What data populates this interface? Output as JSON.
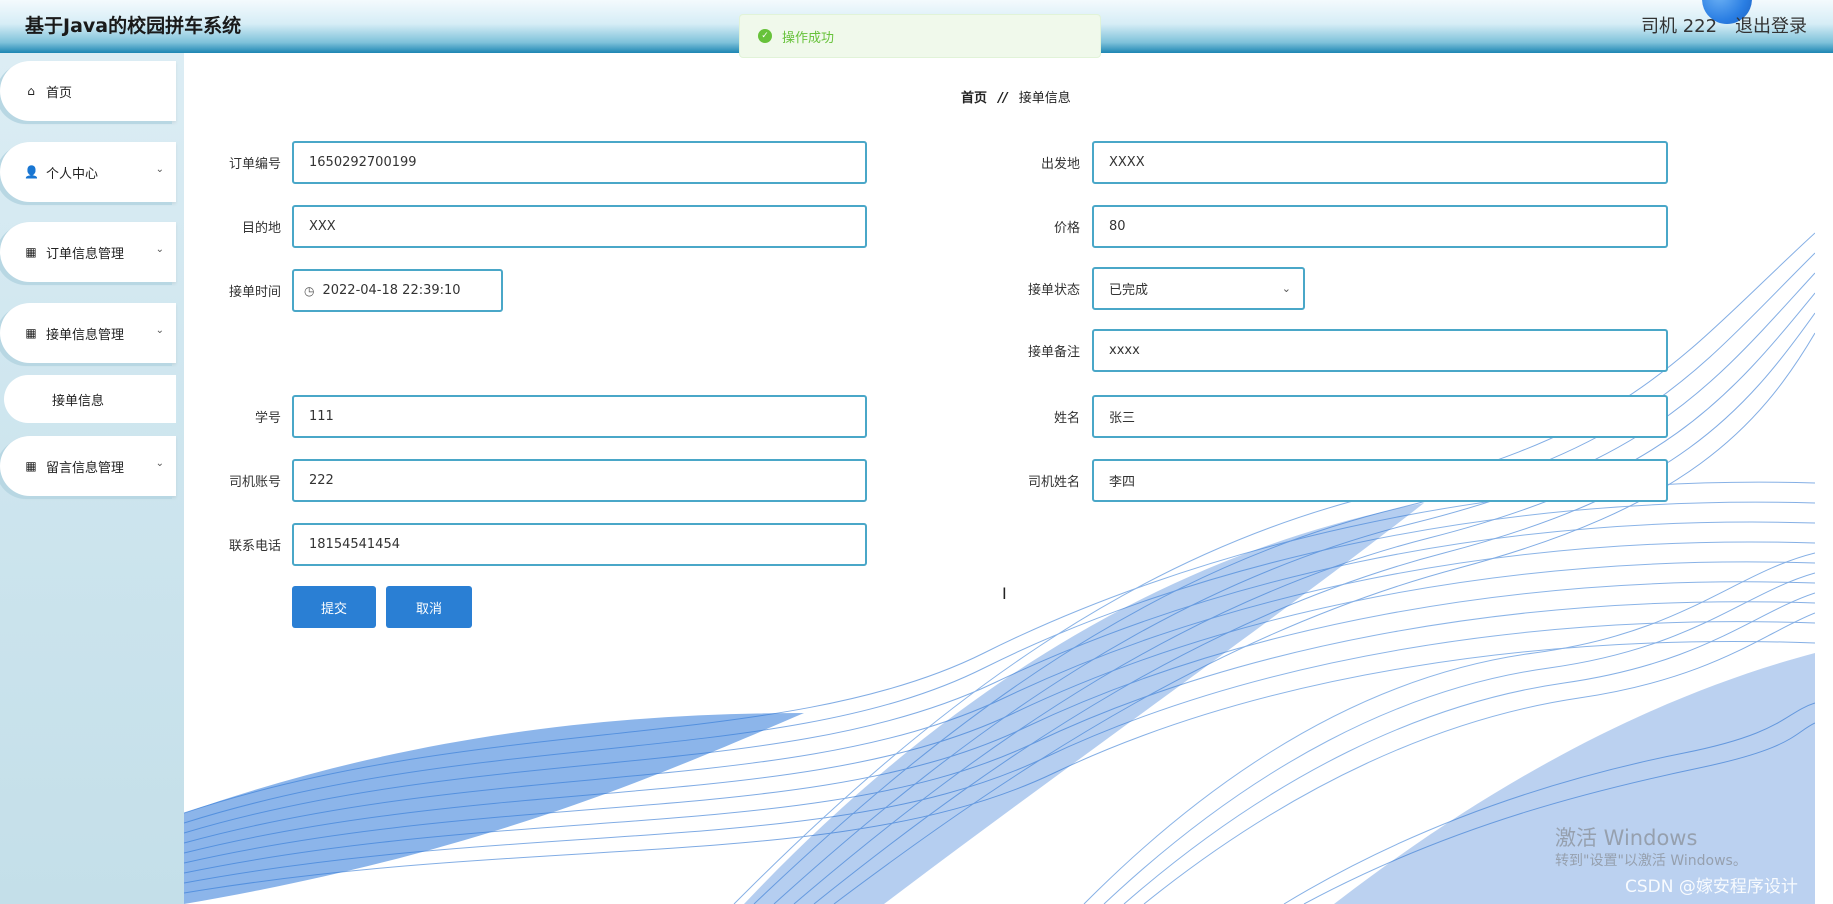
{
  "header": {
    "app_title": "基于Java的校园拼车系统",
    "user_label": "司机 222",
    "logout_label": "退出登录"
  },
  "toast": {
    "message": "操作成功",
    "status_color": "#67c23a"
  },
  "sidebar": {
    "items": [
      {
        "label": "首页",
        "icon": "home-icon"
      },
      {
        "label": "个人中心",
        "icon": "user-icon",
        "expandable": true
      },
      {
        "label": "订单信息管理",
        "icon": "grid-icon",
        "expandable": true
      },
      {
        "label": "接单信息管理",
        "icon": "grid-icon",
        "expandable": true
      },
      {
        "label": "接单信息",
        "sub": true,
        "active": true
      },
      {
        "label": "留言信息管理",
        "icon": "grid-icon",
        "expandable": true
      }
    ]
  },
  "breadcrumb": {
    "home": "首页",
    "separator": "//",
    "current": "接单信息"
  },
  "form": {
    "order_no": {
      "label": "订单编号",
      "value": "1650292700199"
    },
    "origin": {
      "label": "出发地",
      "value": "XXXX"
    },
    "destination": {
      "label": "目的地",
      "value": "XXX"
    },
    "price": {
      "label": "价格",
      "value": "80"
    },
    "accept_time": {
      "label": "接单时间",
      "value": "2022-04-18 22:39:10"
    },
    "accept_status": {
      "label": "接单状态",
      "value": "已完成"
    },
    "accept_remark": {
      "label": "接单备注",
      "value": "xxxx"
    },
    "student_no": {
      "label": "学号",
      "value": "111"
    },
    "name": {
      "label": "姓名",
      "value": "张三"
    },
    "driver_account": {
      "label": "司机账号",
      "value": "222"
    },
    "driver_name": {
      "label": "司机姓名",
      "value": "李四"
    },
    "phone": {
      "label": "联系电话",
      "value": "18154541454"
    },
    "submit_label": "提交",
    "cancel_label": "取消"
  },
  "watermarks": {
    "activate_title": "激活 Windows",
    "activate_sub": "转到\"设置\"以激活 Windows。",
    "csdn": "CSDN @嫁安程序设计"
  },
  "colors": {
    "accent": "#2a7fd4",
    "input_border": "#4aa7c8",
    "header_dark": "#1d86b3"
  }
}
